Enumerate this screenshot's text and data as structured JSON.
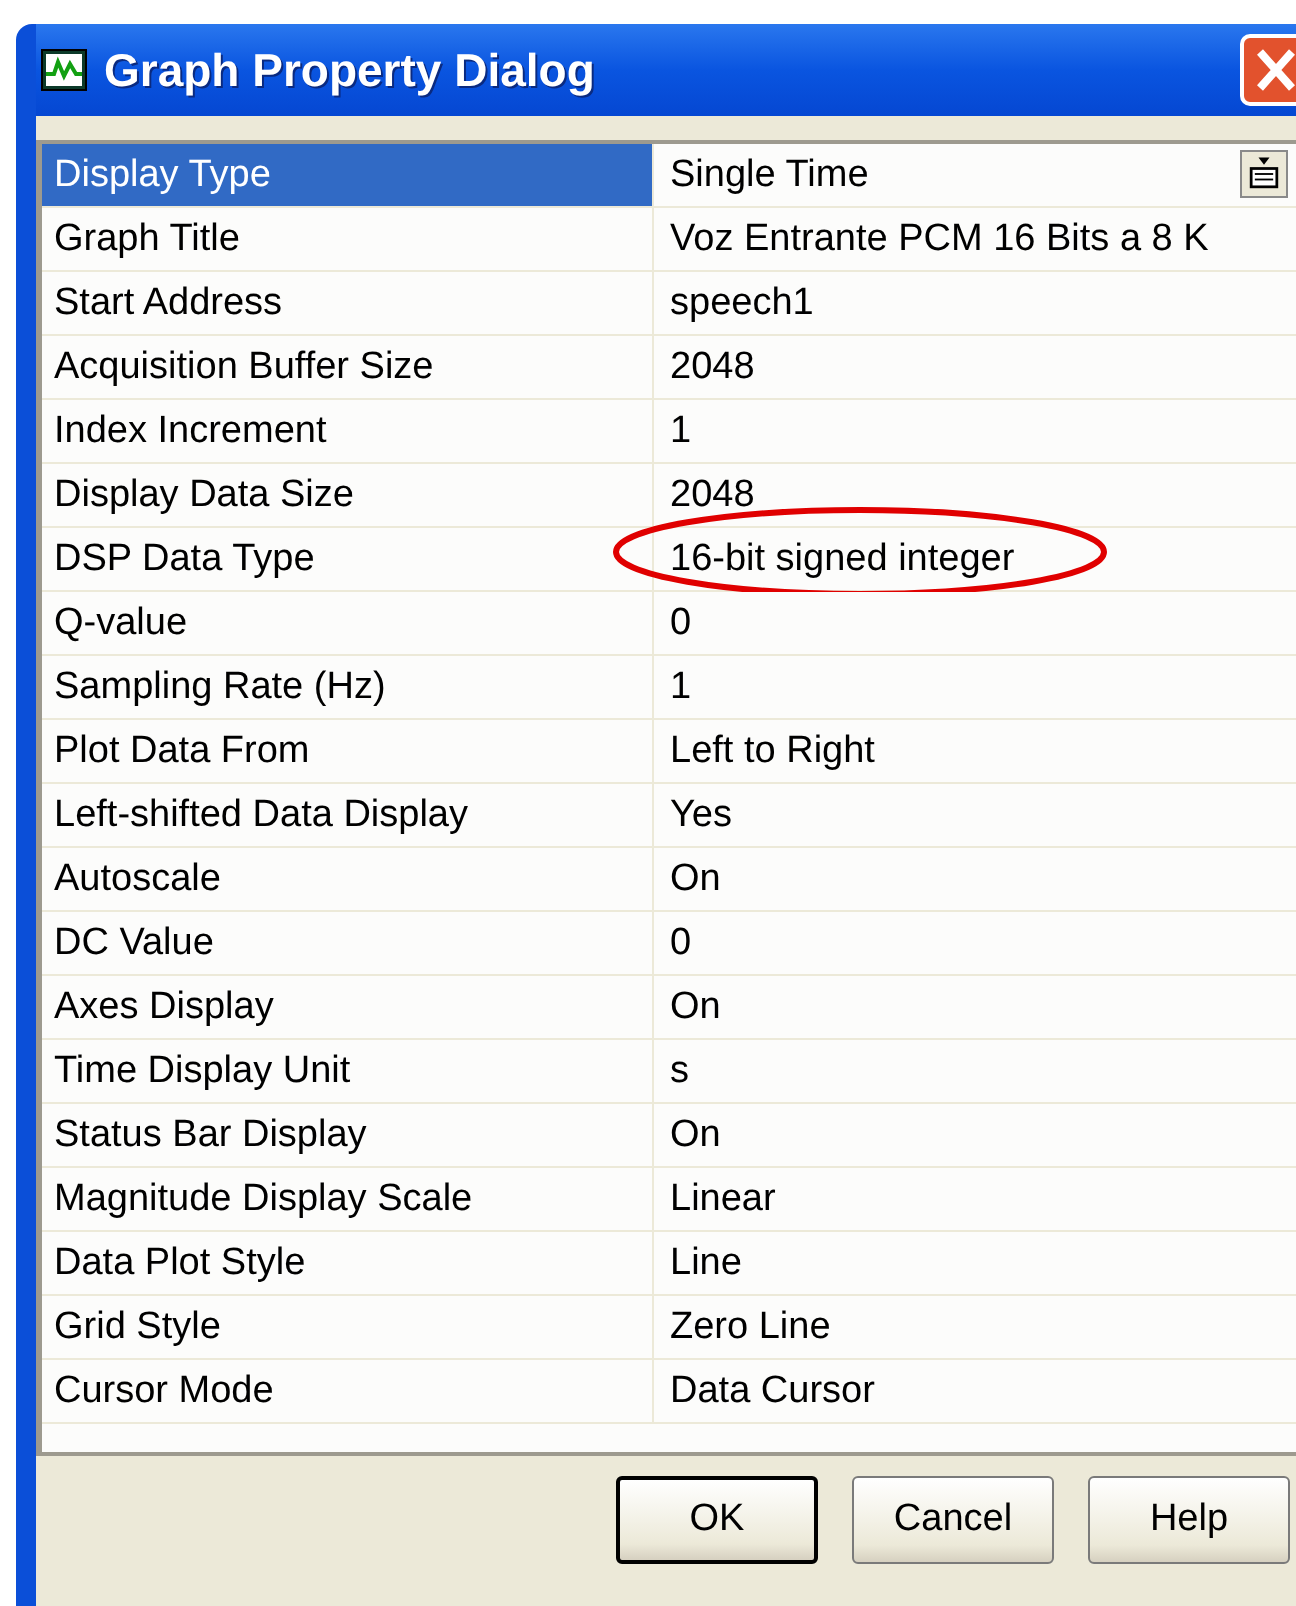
{
  "window": {
    "title": "Graph Property Dialog"
  },
  "properties": [
    {
      "name": "Display Type",
      "value": "Single Time",
      "kind": "dropdown",
      "selected": true,
      "circled": false
    },
    {
      "name": "Graph Title",
      "value": "Voz Entrante PCM 16 Bits a 8 K",
      "kind": "text",
      "selected": false,
      "circled": false
    },
    {
      "name": "Start Address",
      "value": "speech1",
      "kind": "text",
      "selected": false,
      "circled": false
    },
    {
      "name": "Acquisition Buffer Size",
      "value": "2048",
      "kind": "text",
      "selected": false,
      "circled": false
    },
    {
      "name": "Index Increment",
      "value": "1",
      "kind": "text",
      "selected": false,
      "circled": false
    },
    {
      "name": "Display Data Size",
      "value": "2048",
      "kind": "text",
      "selected": false,
      "circled": false
    },
    {
      "name": "DSP Data Type",
      "value": "16-bit signed integer",
      "kind": "text",
      "selected": false,
      "circled": true
    },
    {
      "name": "Q-value",
      "value": "0",
      "kind": "text",
      "selected": false,
      "circled": false
    },
    {
      "name": "Sampling Rate (Hz)",
      "value": "1",
      "kind": "text",
      "selected": false,
      "circled": false
    },
    {
      "name": "Plot Data From",
      "value": "Left to Right",
      "kind": "text",
      "selected": false,
      "circled": false
    },
    {
      "name": "Left-shifted Data Display",
      "value": "Yes",
      "kind": "text",
      "selected": false,
      "circled": false
    },
    {
      "name": "Autoscale",
      "value": "On",
      "kind": "text",
      "selected": false,
      "circled": false
    },
    {
      "name": "DC Value",
      "value": "0",
      "kind": "text",
      "selected": false,
      "circled": false
    },
    {
      "name": "Axes Display",
      "value": "On",
      "kind": "text",
      "selected": false,
      "circled": false
    },
    {
      "name": "Time Display Unit",
      "value": "s",
      "kind": "text",
      "selected": false,
      "circled": false
    },
    {
      "name": "Status Bar Display",
      "value": "On",
      "kind": "text",
      "selected": false,
      "circled": false
    },
    {
      "name": "Magnitude Display Scale",
      "value": "Linear",
      "kind": "text",
      "selected": false,
      "circled": false
    },
    {
      "name": "Data Plot Style",
      "value": "Line",
      "kind": "text",
      "selected": false,
      "circled": false
    },
    {
      "name": "Grid Style",
      "value": "Zero Line",
      "kind": "text",
      "selected": false,
      "circled": false
    },
    {
      "name": "Cursor Mode",
      "value": "Data Cursor",
      "kind": "text",
      "selected": false,
      "circled": false
    }
  ],
  "buttons": [
    {
      "label": "OK",
      "default": true
    },
    {
      "label": "Cancel",
      "default": false
    },
    {
      "label": "Help",
      "default": false
    }
  ]
}
